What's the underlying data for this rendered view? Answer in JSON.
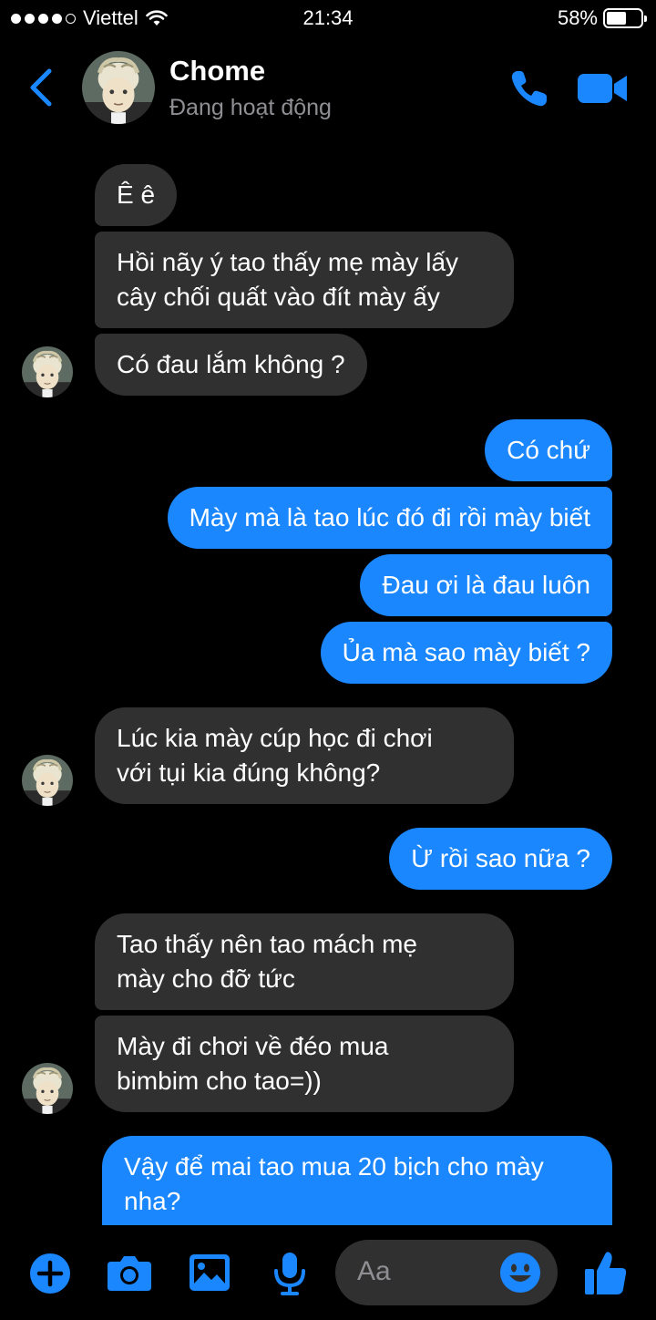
{
  "status_bar": {
    "carrier": "Viettel",
    "time": "21:34",
    "battery": "58%",
    "battery_level": 0.58,
    "signal_bars": 4
  },
  "header": {
    "name": "Chome",
    "status": "Đang hoạt động"
  },
  "messages": [
    {
      "side": "in",
      "lines": [
        "Ê ê"
      ]
    },
    {
      "side": "in",
      "lines": [
        "Hồi nãy ý tao thấy mẹ mày lấy",
        "cây chối quất vào đít mày ấy"
      ]
    },
    {
      "side": "in",
      "lines": [
        "Có đau lắm không ?"
      ]
    },
    {
      "side": "out",
      "lines": [
        "Có chứ"
      ]
    },
    {
      "side": "out",
      "lines": [
        "Mày mà là tao lúc đó đi rồi mày biết"
      ]
    },
    {
      "side": "out",
      "lines": [
        "Đau ơi là đau luôn"
      ]
    },
    {
      "side": "out",
      "lines": [
        "Ủa mà sao mày biết ?"
      ]
    },
    {
      "side": "in",
      "lines": [
        "Lúc kia mày cúp học đi chơi",
        "với tụi kia đúng không?"
      ]
    },
    {
      "side": "out",
      "lines": [
        "Ừ rồi sao nữa ?"
      ]
    },
    {
      "side": "in",
      "lines": [
        "Tao thấy nên tao mách mẹ",
        "mày cho đỡ tức"
      ]
    },
    {
      "side": "in",
      "lines": [
        "Mày đi chơi về đéo mua",
        "bimbim cho tao=))"
      ]
    },
    {
      "side": "out",
      "lines": [
        "Vậy để mai tao mua 20 bịch cho mày",
        "nha?"
      ]
    }
  ],
  "composer": {
    "placeholder": "Aa"
  },
  "icons": {
    "back": "chevron-left-icon",
    "call": "phone-icon",
    "video": "video-camera-icon",
    "add": "plus-circle-icon",
    "camera": "camera-icon",
    "gallery": "image-icon",
    "mic": "microphone-icon",
    "emoji": "smiley-icon",
    "like": "thumbs-up-icon"
  },
  "colors": {
    "accent": "#1b87ff",
    "incoming_bubble": "#303030",
    "background": "#000000"
  }
}
